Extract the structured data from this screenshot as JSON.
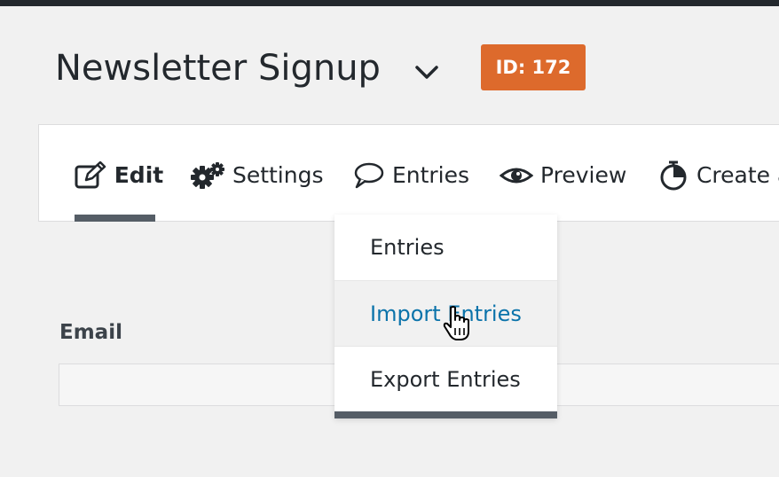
{
  "header": {
    "form_title": "Newsletter Signup",
    "id_badge": "ID: 172",
    "badge_color": "#dd6a2c",
    "dropdown_icon": "chevron-down-icon"
  },
  "tabs": [
    {
      "label": "Edit",
      "icon": "pencil-edit-icon",
      "active": true
    },
    {
      "label": "Settings",
      "icon": "gears-icon"
    },
    {
      "label": "Entries",
      "icon": "speech-bubble-icon"
    },
    {
      "label": "Preview",
      "icon": "eye-icon"
    },
    {
      "label": "Create a",
      "icon": "dashboard-icon"
    }
  ],
  "entries_menu": {
    "items": [
      {
        "label": "Entries"
      },
      {
        "label": "Import Entries",
        "hovered": true
      },
      {
        "label": "Export Entries"
      }
    ],
    "hover_color": "#0b73aa"
  },
  "form": {
    "field_label": "Email",
    "field_value": ""
  },
  "cursor_icon": "hand-pointer-icon"
}
